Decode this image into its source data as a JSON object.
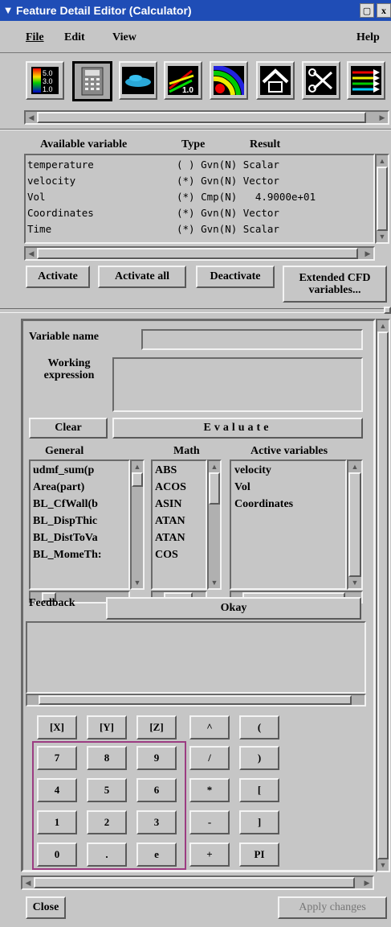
{
  "window": {
    "title": "Feature Detail Editor (Calculator)",
    "title_bar_color": "#1f4db6"
  },
  "menu": {
    "file": "File",
    "edit": "Edit",
    "view": "View",
    "help": "Help"
  },
  "toolbar_icons": [
    "color-scale-icon",
    "calculator-icon",
    "car-model-icon",
    "line-plot-icon",
    "contour-icon",
    "warp-icon",
    "scissors-icon",
    "vectors-icon"
  ],
  "variables": {
    "headers": {
      "name": "Available variable",
      "type": "Type",
      "result": "Result"
    },
    "rows": [
      {
        "name": "temperature",
        "type": "( ) Gvn(N) Scalar"
      },
      {
        "name": "velocity",
        "type": "(*) Gvn(N) Vector"
      },
      {
        "name": "Vol",
        "type": "(*) Cmp(N)   4.9000e+01"
      },
      {
        "name": "Coordinates",
        "type": "(*) Gvn(N) Vector"
      },
      {
        "name": "Time",
        "type": "(*) Gvn(N) Scalar"
      }
    ]
  },
  "actions": {
    "activate": "Activate",
    "activate_all": "Activate all",
    "deactivate": "Deactivate",
    "extended_1": "Extended CFD",
    "extended_2": "variables..."
  },
  "calc": {
    "variable_name_label": "Variable name",
    "variable_name_value": "",
    "working_label_1": "Working",
    "working_label_2": "expression",
    "working_value": "",
    "clear": "Clear",
    "evaluate": "Evaluate",
    "general_header": "General",
    "math_header": "Math",
    "active_header": "Active variables",
    "general_items": [
      "udmf_sum(p",
      "Area(part)",
      "BL_CfWall(b",
      "BL_DispThic",
      "BL_DistToVa",
      "BL_MomeTh:"
    ],
    "math_items": [
      "ABS",
      "ACOS",
      "ASIN",
      "ATAN",
      "ATAN",
      "COS"
    ],
    "active_items": [
      "velocity",
      "Vol",
      "Coordinates"
    ],
    "feedback_label": "Feedback",
    "okay": "Okay",
    "feedback_text": ""
  },
  "keypad": {
    "row1": [
      "[X]",
      "[Y]",
      "[Z]",
      "^",
      "("
    ],
    "row2": [
      "7",
      "8",
      "9",
      "/",
      ")"
    ],
    "row3": [
      "4",
      "5",
      "6",
      "*",
      "["
    ],
    "row4": [
      "1",
      "2",
      "3",
      "-",
      "]"
    ],
    "row5": [
      "0",
      ".",
      "e",
      "+",
      "PI"
    ]
  },
  "footer": {
    "close": "Close",
    "apply": "Apply changes"
  }
}
